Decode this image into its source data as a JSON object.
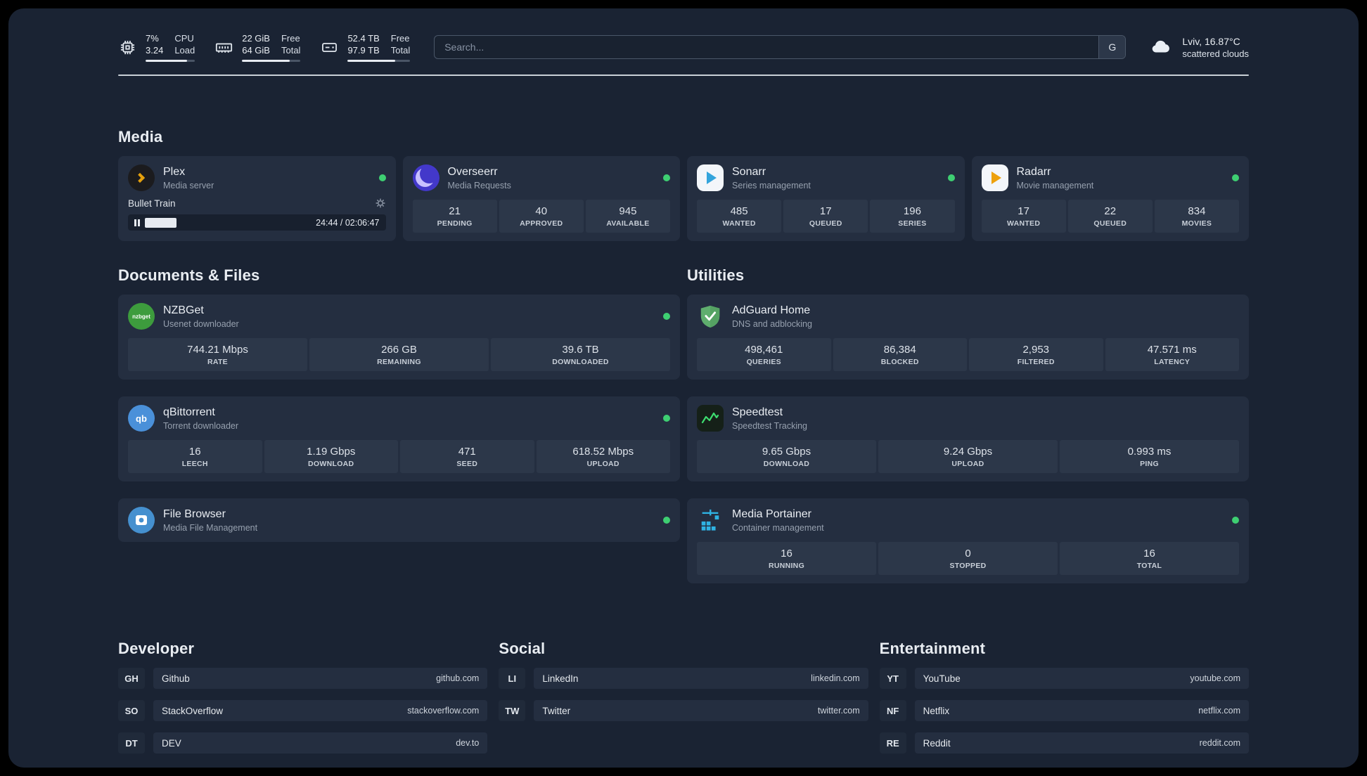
{
  "topbar": {
    "cpu": {
      "usage": "7%",
      "load": "3.24",
      "label_top": "CPU",
      "label_bottom": "Load",
      "bar_percent": 84
    },
    "ram": {
      "free": "22 GiB",
      "total": "64 GiB",
      "label_top": "Free",
      "label_bottom": "Total",
      "bar_percent": 82
    },
    "disk": {
      "free": "52.4 TB",
      "total": "97.9 TB",
      "label_top": "Free",
      "label_bottom": "Total",
      "bar_percent": 76
    },
    "search": {
      "placeholder": "Search...",
      "engine_label": "G"
    },
    "weather": {
      "location": "Lviv, 16.87°C",
      "condition": "scattered clouds"
    }
  },
  "media": {
    "heading": "Media",
    "plex": {
      "title": "Plex",
      "subtitle": "Media server",
      "online": true,
      "now_playing": "Bullet Train",
      "time": "24:44 / 02:06:47",
      "progress_percent": 19.5
    },
    "overseerr": {
      "title": "Overseerr",
      "subtitle": "Media Requests",
      "online": true,
      "stats": [
        {
          "value": "21",
          "label": "PENDING"
        },
        {
          "value": "40",
          "label": "APPROVED"
        },
        {
          "value": "945",
          "label": "AVAILABLE"
        }
      ]
    },
    "sonarr": {
      "title": "Sonarr",
      "subtitle": "Series management",
      "online": true,
      "stats": [
        {
          "value": "485",
          "label": "WANTED"
        },
        {
          "value": "17",
          "label": "QUEUED"
        },
        {
          "value": "196",
          "label": "SERIES"
        }
      ]
    },
    "radarr": {
      "title": "Radarr",
      "subtitle": "Movie management",
      "online": true,
      "stats": [
        {
          "value": "17",
          "label": "WANTED"
        },
        {
          "value": "22",
          "label": "QUEUED"
        },
        {
          "value": "834",
          "label": "MOVIES"
        }
      ]
    }
  },
  "documents": {
    "heading": "Documents & Files",
    "nzbget": {
      "title": "NZBGet",
      "subtitle": "Usenet downloader",
      "online": true,
      "icon_text": "nzbget",
      "stats": [
        {
          "value": "744.21 Mbps",
          "label": "RATE"
        },
        {
          "value": "266 GB",
          "label": "REMAINING"
        },
        {
          "value": "39.6 TB",
          "label": "DOWNLOADED"
        }
      ]
    },
    "qbittorrent": {
      "title": "qBittorrent",
      "subtitle": "Torrent downloader",
      "online": true,
      "icon_text": "qb",
      "stats": [
        {
          "value": "16",
          "label": "LEECH"
        },
        {
          "value": "1.19 Gbps",
          "label": "DOWNLOAD"
        },
        {
          "value": "471",
          "label": "SEED"
        },
        {
          "value": "618.52 Mbps",
          "label": "UPLOAD"
        }
      ]
    },
    "filebrowser": {
      "title": "File Browser",
      "subtitle": "Media File Management",
      "online": true
    }
  },
  "utilities": {
    "heading": "Utilities",
    "adguard": {
      "title": "AdGuard Home",
      "subtitle": "DNS and adblocking",
      "stats": [
        {
          "value": "498,461",
          "label": "QUERIES"
        },
        {
          "value": "86,384",
          "label": "BLOCKED"
        },
        {
          "value": "2,953",
          "label": "FILTERED"
        },
        {
          "value": "47.571 ms",
          "label": "LATENCY"
        }
      ]
    },
    "speedtest": {
      "title": "Speedtest",
      "subtitle": "Speedtest Tracking",
      "stats": [
        {
          "value": "9.65 Gbps",
          "label": "DOWNLOAD"
        },
        {
          "value": "9.24 Gbps",
          "label": "UPLOAD"
        },
        {
          "value": "0.993 ms",
          "label": "PING"
        }
      ]
    },
    "portainer": {
      "title": "Media Portainer",
      "subtitle": "Container management",
      "online": true,
      "stats": [
        {
          "value": "16",
          "label": "RUNNING"
        },
        {
          "value": "0",
          "label": "STOPPED"
        },
        {
          "value": "16",
          "label": "TOTAL"
        }
      ]
    }
  },
  "developer": {
    "heading": "Developer",
    "links": [
      {
        "abbr": "GH",
        "name": "Github",
        "domain": "github.com"
      },
      {
        "abbr": "SO",
        "name": "StackOverflow",
        "domain": "stackoverflow.com"
      },
      {
        "abbr": "DT",
        "name": "DEV",
        "domain": "dev.to"
      }
    ]
  },
  "social": {
    "heading": "Social",
    "links": [
      {
        "abbr": "LI",
        "name": "LinkedIn",
        "domain": "linkedin.com"
      },
      {
        "abbr": "TW",
        "name": "Twitter",
        "domain": "twitter.com"
      }
    ]
  },
  "entertainment": {
    "heading": "Entertainment",
    "links": [
      {
        "abbr": "YT",
        "name": "YouTube",
        "domain": "youtube.com"
      },
      {
        "abbr": "NF",
        "name": "Netflix",
        "domain": "netflix.com"
      },
      {
        "abbr": "RE",
        "name": "Reddit",
        "domain": "reddit.com"
      }
    ]
  },
  "colors": {
    "background": "#1a2333",
    "card": "#242e40",
    "stat_tile": "#2c3749",
    "status_online": "#3ecf72",
    "plex_gold": "#e5a00d",
    "overseerr_purple": "#4338ca",
    "sonarr_blue": "#33a4dc",
    "radarr_orange": "#eda10d",
    "nzbget_green": "#3d9c3d",
    "qbittorrent_blue": "#4a90d9",
    "filebrowser_blue": "#4590cf",
    "adguard_green": "#5fae6e",
    "speedtest_green": "#3ddc6f",
    "portainer_cyan": "#2fb3e3"
  }
}
